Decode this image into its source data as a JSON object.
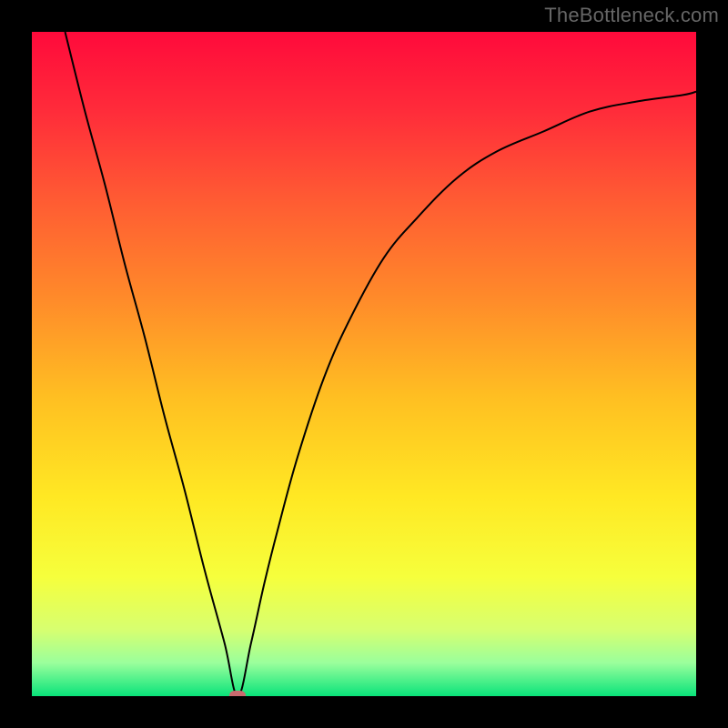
{
  "watermark": "TheBottleneck.com",
  "chart_data": {
    "type": "line",
    "title": "",
    "xlabel": "",
    "ylabel": "",
    "xlim": [
      0,
      100
    ],
    "ylim": [
      0,
      100
    ],
    "grid": false,
    "marker": {
      "x": 31,
      "y": 0,
      "color": "#c96a6f"
    },
    "gradient_stops": [
      {
        "pos": 0.0,
        "color": "#ff0a3b"
      },
      {
        "pos": 0.12,
        "color": "#ff2c3a"
      },
      {
        "pos": 0.25,
        "color": "#ff5a33"
      },
      {
        "pos": 0.4,
        "color": "#ff8a2a"
      },
      {
        "pos": 0.55,
        "color": "#ffbf22"
      },
      {
        "pos": 0.7,
        "color": "#ffe823"
      },
      {
        "pos": 0.82,
        "color": "#f6ff3c"
      },
      {
        "pos": 0.9,
        "color": "#d7ff70"
      },
      {
        "pos": 0.95,
        "color": "#9aff9c"
      },
      {
        "pos": 1.0,
        "color": "#09e37a"
      }
    ],
    "series": [
      {
        "name": "curve",
        "color": "#000000",
        "stroke_width": 2,
        "x": [
          5,
          8,
          11,
          14,
          17,
          20,
          23,
          26,
          29,
          31,
          33,
          35,
          37,
          40,
          44,
          48,
          53,
          58,
          64,
          70,
          77,
          84,
          91,
          98,
          100
        ],
        "y": [
          100,
          88,
          77,
          65,
          54,
          42,
          31,
          19,
          8,
          0,
          8,
          17,
          25,
          36,
          48,
          57,
          66,
          72,
          78,
          82,
          85,
          88,
          89.5,
          90.5,
          91
        ]
      }
    ]
  }
}
